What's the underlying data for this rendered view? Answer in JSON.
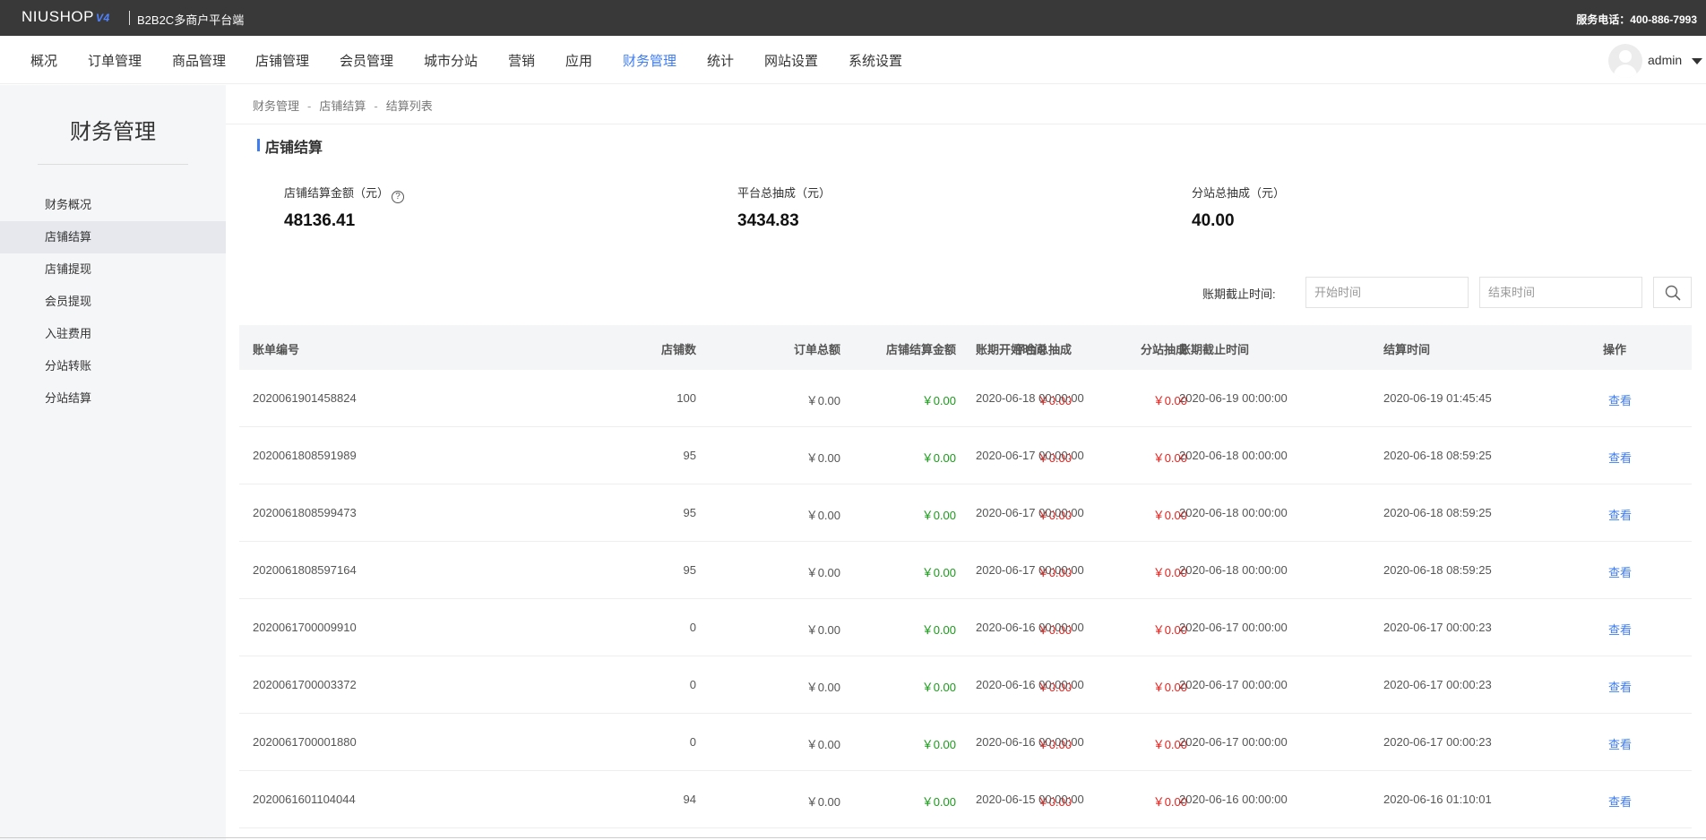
{
  "topbar": {
    "logo": "NIUSHOP",
    "logo_version": "V4",
    "platform": "B2B2C多商户平台端",
    "service": "服务电话：400-886-7993"
  },
  "nav": {
    "items": [
      "概况",
      "订单管理",
      "商品管理",
      "店铺管理",
      "会员管理",
      "城市分站",
      "营销",
      "应用",
      "财务管理",
      "统计",
      "网站设置",
      "系统设置"
    ],
    "active": "财务管理",
    "username": "admin"
  },
  "sidebar": {
    "title": "财务管理",
    "items": [
      "财务概况",
      "店铺结算",
      "店铺提现",
      "会员提现",
      "入驻费用",
      "分站转账",
      "分站结算"
    ],
    "active": "店铺结算"
  },
  "breadcrumb": [
    "财务管理",
    "店铺结算",
    "结算列表"
  ],
  "section_title": "店铺结算",
  "stats": [
    {
      "label": "店铺结算金额（元）",
      "value": "48136.41",
      "help": "?"
    },
    {
      "label": "平台总抽成（元）",
      "value": "3434.83"
    },
    {
      "label": "分站总抽成（元）",
      "value": "40.00"
    }
  ],
  "filter": {
    "label": "账期截止时间:",
    "start_placeholder": "开始时间",
    "end_placeholder": "结束时间"
  },
  "table": {
    "headers": [
      "账单编号",
      "店铺数",
      "订单总额",
      "店铺结算金额",
      "平台总抽成",
      "分站抽成",
      "账期开始时间",
      "账期截止时间",
      "结算时间",
      "操作"
    ],
    "rows": [
      {
        "id": "2020061901458824",
        "shops": "100",
        "total": "￥0.00",
        "settle": "￥0.00",
        "platform": "￥0.00",
        "branch": "￥0.00",
        "start": "2020-06-18 00:00:00",
        "end": "2020-06-19 00:00:00",
        "time": "2020-06-19 01:45:45",
        "action": "查看"
      },
      {
        "id": "2020061808591989",
        "shops": "95",
        "total": "￥0.00",
        "settle": "￥0.00",
        "platform": "￥0.00",
        "branch": "￥0.00",
        "start": "2020-06-17 00:00:00",
        "end": "2020-06-18 00:00:00",
        "time": "2020-06-18 08:59:25",
        "action": "查看"
      },
      {
        "id": "2020061808599473",
        "shops": "95",
        "total": "￥0.00",
        "settle": "￥0.00",
        "platform": "￥0.00",
        "branch": "￥0.00",
        "start": "2020-06-17 00:00:00",
        "end": "2020-06-18 00:00:00",
        "time": "2020-06-18 08:59:25",
        "action": "查看"
      },
      {
        "id": "2020061808597164",
        "shops": "95",
        "total": "￥0.00",
        "settle": "￥0.00",
        "platform": "￥0.00",
        "branch": "￥0.00",
        "start": "2020-06-17 00:00:00",
        "end": "2020-06-18 00:00:00",
        "time": "2020-06-18 08:59:25",
        "action": "查看"
      },
      {
        "id": "2020061700009910",
        "shops": "0",
        "total": "￥0.00",
        "settle": "￥0.00",
        "platform": "￥0.00",
        "branch": "￥0.00",
        "start": "2020-06-16 00:00:00",
        "end": "2020-06-17 00:00:00",
        "time": "2020-06-17 00:00:23",
        "action": "查看"
      },
      {
        "id": "2020061700003372",
        "shops": "0",
        "total": "￥0.00",
        "settle": "￥0.00",
        "platform": "￥0.00",
        "branch": "￥0.00",
        "start": "2020-06-16 00:00:00",
        "end": "2020-06-17 00:00:00",
        "time": "2020-06-17 00:00:23",
        "action": "查看"
      },
      {
        "id": "2020061700001880",
        "shops": "0",
        "total": "￥0.00",
        "settle": "￥0.00",
        "platform": "￥0.00",
        "branch": "￥0.00",
        "start": "2020-06-16 00:00:00",
        "end": "2020-06-17 00:00:00",
        "time": "2020-06-17 00:00:23",
        "action": "查看"
      },
      {
        "id": "2020061601104044",
        "shops": "94",
        "total": "￥0.00",
        "settle": "￥0.00",
        "platform": "￥0.00",
        "branch": "￥0.00",
        "start": "2020-06-15 00:00:00",
        "end": "2020-06-16 00:00:00",
        "time": "2020-06-16 01:10:01",
        "action": "查看"
      }
    ]
  },
  "colors": {
    "accent": "#3e7cf3",
    "settle_amount": "#1a9b1a",
    "commission": "#e8201c",
    "topbar": "#393939"
  }
}
